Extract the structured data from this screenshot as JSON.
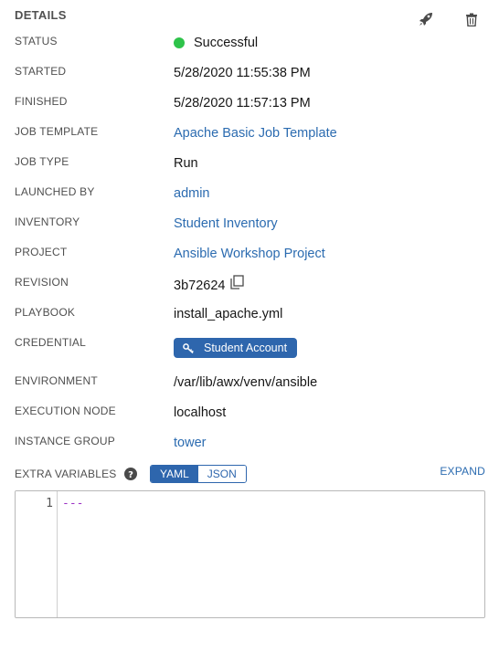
{
  "header": {
    "title": "DETAILS",
    "relaunch_icon": "rocket-icon",
    "delete_icon": "trash-icon"
  },
  "details": {
    "status": {
      "label": "STATUS",
      "value": "Successful",
      "color": "#2ec34a"
    },
    "started": {
      "label": "STARTED",
      "value": "5/28/2020 11:55:38 PM"
    },
    "finished": {
      "label": "FINISHED",
      "value": "5/28/2020 11:57:13 PM"
    },
    "job_template": {
      "label": "JOB TEMPLATE",
      "value": "Apache Basic Job Template"
    },
    "job_type": {
      "label": "JOB TYPE",
      "value": "Run"
    },
    "launched_by": {
      "label": "LAUNCHED BY",
      "value": "admin"
    },
    "inventory": {
      "label": "INVENTORY",
      "value": "Student Inventory"
    },
    "project": {
      "label": "PROJECT",
      "value": "Ansible Workshop Project"
    },
    "revision": {
      "label": "REVISION",
      "value": "3b72624"
    },
    "playbook": {
      "label": "PLAYBOOK",
      "value": "install_apache.yml"
    },
    "credential": {
      "label": "CREDENTIAL",
      "value": "Student Account"
    },
    "environment": {
      "label": "ENVIRONMENT",
      "value": "/var/lib/awx/venv/ansible"
    },
    "execution_node": {
      "label": "EXECUTION NODE",
      "value": "localhost"
    },
    "instance_group": {
      "label": "INSTANCE GROUP",
      "value": "tower"
    }
  },
  "extra_vars": {
    "label": "EXTRA VARIABLES",
    "modes": [
      "YAML",
      "JSON"
    ],
    "active_mode": "YAML",
    "expand_label": "EXPAND",
    "lines": [
      {
        "number": "1",
        "text": "---"
      }
    ]
  },
  "colors": {
    "link": "#2b6bb0",
    "accent": "#2e66ad",
    "success": "#2ec34a"
  }
}
